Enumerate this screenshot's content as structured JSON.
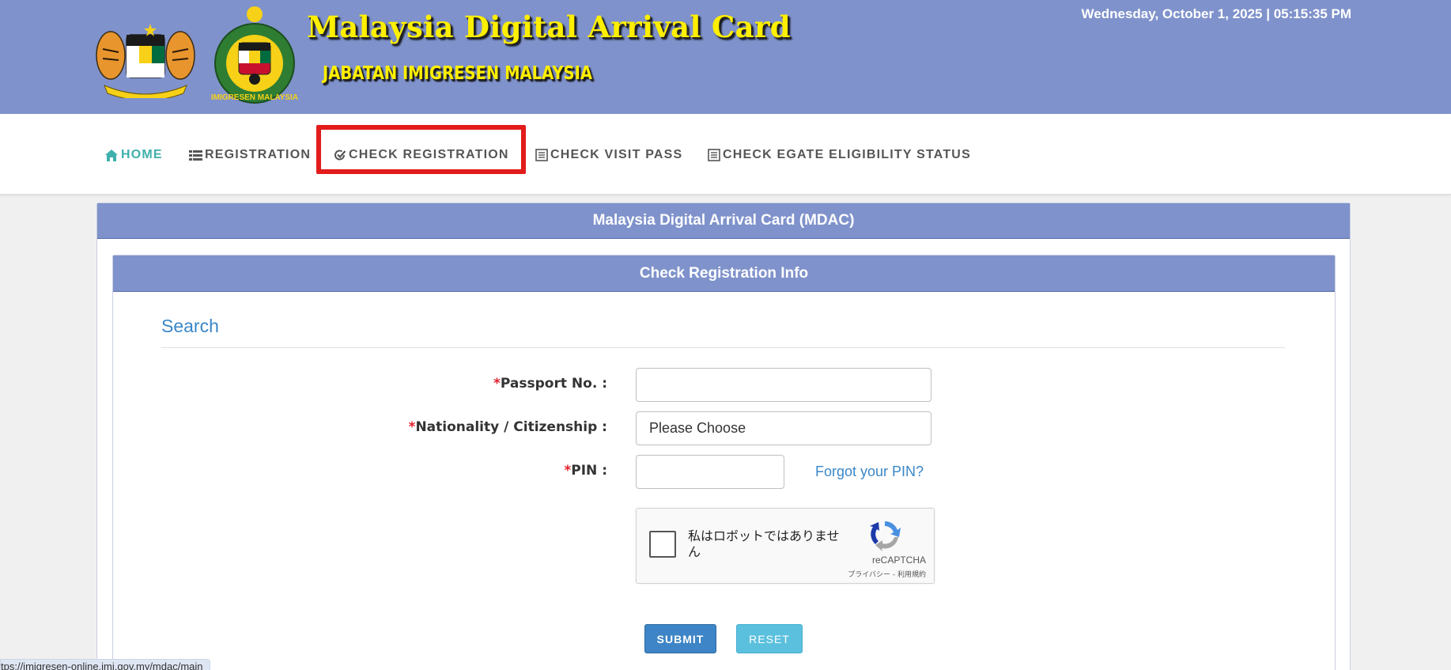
{
  "header": {
    "datetime": "Wednesday, October 1, 2025 | 05:15:35 PM",
    "title": "Malaysia Digital Arrival Card",
    "subtitle": "JABATAN IMIGRESEN MALAYSIA",
    "crest2_ring_text": "IMIGRESEN MALAYSIA",
    "colors": {
      "header_bg": "#7f92cb",
      "title_yellow": "#ffef00"
    }
  },
  "nav": {
    "items": [
      {
        "label": "HOME",
        "icon": "home-icon",
        "active": true
      },
      {
        "label": "REGISTRATION",
        "icon": "list-icon"
      },
      {
        "label": "CHECK REGISTRATION",
        "icon": "check-circle-icon"
      },
      {
        "label": "CHECK VISIT PASS",
        "icon": "document-icon"
      },
      {
        "label": "CHECK EGATE ELIGIBILITY STATUS",
        "icon": "document-icon"
      }
    ],
    "colors": {
      "active": "#3fb0ac",
      "default": "#555555",
      "highlight": "#e21b1b"
    }
  },
  "panel": {
    "title": "Malaysia Digital Arrival Card (MDAC)",
    "inner_title": "Check Registration Info",
    "section_title": "Search"
  },
  "form": {
    "required_mark": "*",
    "passport_label": "Passport No. :",
    "passport_value": "",
    "nationality_label": "Nationality / Citizenship :",
    "nationality_value": "Please Choose",
    "pin_label": "PIN :",
    "pin_value": "",
    "forgot_pin": "Forgot your PIN?"
  },
  "captcha": {
    "checkbox_text": "私はロボットではありません",
    "brand": "reCAPTCHA",
    "terms": "プライバシー - 利用規約"
  },
  "buttons": {
    "submit": "SUBMIT",
    "reset": "RESET"
  },
  "status_bar": {
    "url": "tps://imigresen-online.imi.gov.my/mdac/main"
  }
}
